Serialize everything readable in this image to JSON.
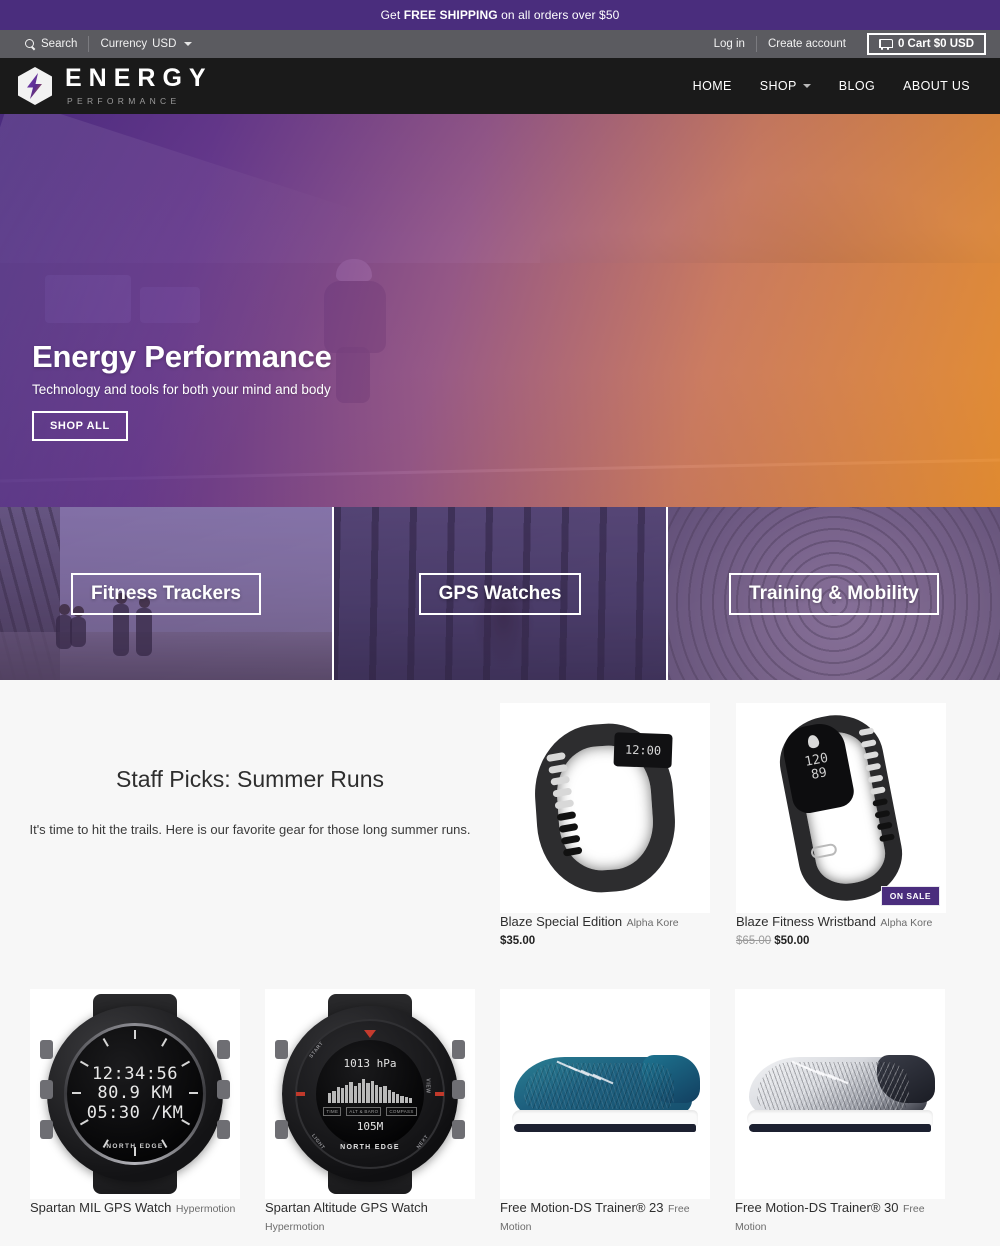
{
  "announcement": {
    "prefix": "Get ",
    "strong": "FREE SHIPPING",
    "suffix": " on all orders over $50"
  },
  "utility_bar": {
    "search_label": "Search",
    "currency_label": "Currency",
    "currency_value": "USD",
    "login_label": "Log in",
    "create_account_label": "Create account",
    "cart_label": "0 Cart $0 USD",
    "icons": {
      "search": "search-icon",
      "caret": "chevron-down-icon",
      "cart": "cart-icon"
    }
  },
  "header": {
    "logo_name": "ENERGY",
    "logo_sub": "PERFORMANCE",
    "nav": [
      {
        "label": "HOME",
        "has_caret": false
      },
      {
        "label": "SHOP",
        "has_caret": true
      },
      {
        "label": "BLOG",
        "has_caret": false
      },
      {
        "label": "ABOUT US",
        "has_caret": false
      }
    ]
  },
  "hero": {
    "title": "Energy Performance",
    "subtitle": "Technology and tools for both your mind and body",
    "button_label": "SHOP ALL"
  },
  "categories": [
    {
      "label": "Fitness Trackers"
    },
    {
      "label": "GPS Watches"
    },
    {
      "label": "Training & Mobility"
    }
  ],
  "picks": {
    "title": "Staff Picks: Summer Runs",
    "description": "It's time to hit the trails. Here is our favorite gear for those long summer runs."
  },
  "products_top": [
    {
      "title": "Blaze Special Edition",
      "vendor": "Alpha Kore",
      "price": "$35.00",
      "compare_price": "",
      "badge": "",
      "display": {
        "time": "12:00"
      }
    },
    {
      "title": "Blaze Fitness Wristband",
      "vendor": "Alpha Kore",
      "price": "$50.00",
      "compare_price": "$65.00",
      "badge": "ON SALE",
      "display": {
        "line1": "120",
        "line2": "89"
      }
    }
  ],
  "products_bottom": [
    {
      "title": "Spartan MIL GPS Watch",
      "vendor": "Hypermotion",
      "price": "",
      "display": {
        "line1": "12:34:56",
        "line2": "80.9 KM",
        "line3": "05:30 /KM",
        "brand": "NORTH EDGE"
      }
    },
    {
      "title": "Spartan Altitude GPS Watch",
      "vendor": "Hypermotion",
      "price": "",
      "display": {
        "pressure": "1013 hPa",
        "altitude": "105M",
        "brand": "NORTH EDGE",
        "tabs": [
          "TIME",
          "ALT & BARO",
          "COMPASS"
        ]
      }
    },
    {
      "title": "Free Motion-DS Trainer® 23",
      "vendor": "Free Motion",
      "price": ""
    },
    {
      "title": "Free Motion-DS Trainer® 30",
      "vendor": "Free Motion",
      "price": ""
    }
  ],
  "colors": {
    "accent_purple": "#4a2d7d",
    "utility_gray": "#5b5b60",
    "header_black": "#1a1a1a",
    "section_bg": "#f7f7f7",
    "sale_badge": "#4a2d7d"
  }
}
